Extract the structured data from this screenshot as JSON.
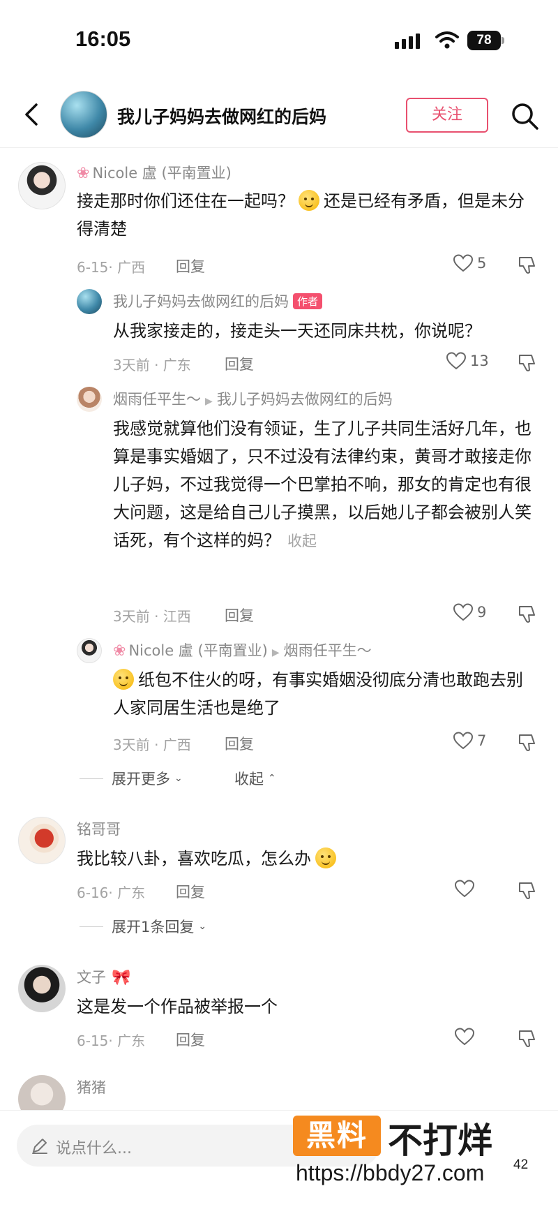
{
  "status_bar": {
    "time": "16:05",
    "battery": "78"
  },
  "header": {
    "title": "我儿子妈妈去做网红的后妈",
    "follow_label": "关注"
  },
  "comments": [
    {
      "name": "Nicole 盧 (平南置业)",
      "text_a": "接走那时你们还住在一起吗？",
      "text_b": "还是已经有矛盾，但是未分得清楚",
      "date": "6-15· 广西",
      "reply": "回复",
      "likes": "5"
    },
    {
      "name": "铭哥哥",
      "text": "我比较八卦，喜欢吃瓜，怎么办",
      "date": "6-16· 广东",
      "reply": "回复",
      "expand": "展开1条回复"
    },
    {
      "name": "文子",
      "text": "这是发一个作品被举报一个",
      "date": "6-15· 广东",
      "reply": "回复"
    },
    {
      "name": "猪猪"
    }
  ],
  "replies": [
    {
      "name": "我儿子妈妈去做网红的后妈",
      "author_tag": "作者",
      "text": "从我家接走的，接走头一天还同床共枕，你说呢？",
      "date": "3天前 · 广东",
      "reply": "回复",
      "likes": "13"
    },
    {
      "name": "烟雨任平生～",
      "reply_to": "我儿子妈妈去做网红的后妈",
      "text": "我感觉就算他们没有领证，生了儿子共同生活好几年，也算是事实婚姻了，只不过没有法律约束，黄哥才敢接走你儿子妈，不过我觉得一个巴掌拍不响，那女的肯定也有很大问题，这是给自己儿子摸黑，以后她儿子都会被别人笑话死，有个这样的妈？",
      "collapse": "收起",
      "date": "3天前 · 江西",
      "reply": "回复",
      "likes": "9"
    },
    {
      "name": "Nicole 盧 (平南置业)",
      "reply_to": "烟雨任平生～",
      "text": "纸包不住火的呀，有事实婚姻没彻底分清也敢跑去别人家同居生活也是绝了",
      "date": "3天前 · 广西",
      "reply": "回复",
      "likes": "7"
    }
  ],
  "thread_controls": {
    "expand_more": "展开更多",
    "collapse": "收起"
  },
  "bottom": {
    "placeholder": "说点什么..."
  },
  "watermark": {
    "box": "黑料",
    "text": "不打烊",
    "url": "https://bbdy27.com",
    "page": "42"
  },
  "colors": {
    "accent": "#e8506f",
    "watermark_orange": "#f58a1f"
  }
}
